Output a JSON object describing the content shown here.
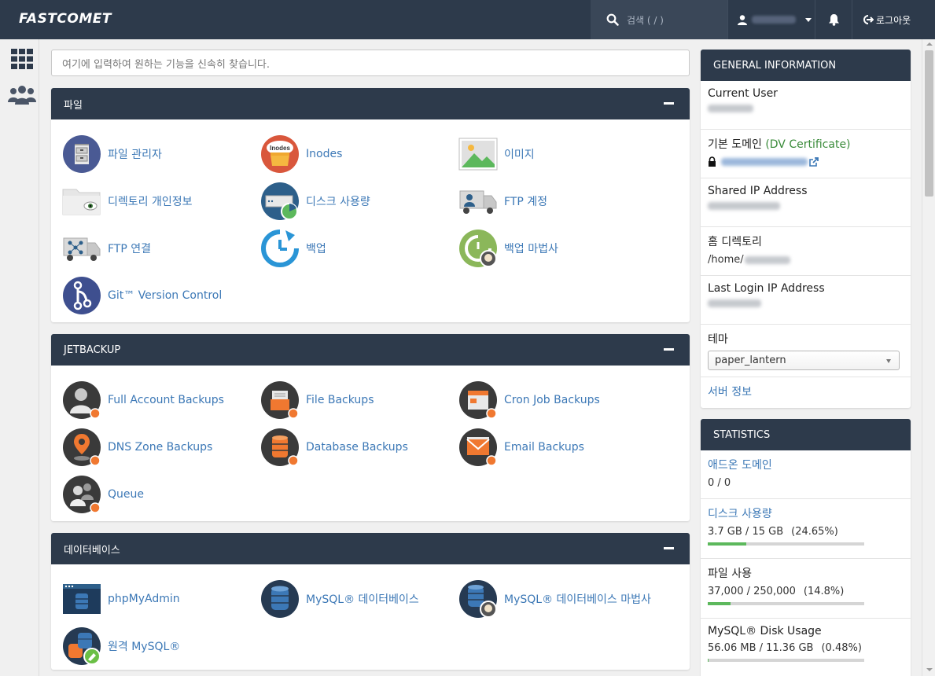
{
  "topbar": {
    "logo": "FASTCOMET",
    "search_placeholder": "검색 ( / )",
    "logout_label": "로그아웃"
  },
  "search": {
    "placeholder": "여기에 입력하여 원하는 기능을 신속히 찾습니다."
  },
  "panels": [
    {
      "title": "파일",
      "items": [
        {
          "label": "파일 관리자",
          "icon": "file-manager-icon"
        },
        {
          "label": "Inodes",
          "icon": "inodes-icon",
          "icon_text": "Inodes"
        },
        {
          "label": "이미지",
          "icon": "images-icon"
        },
        {
          "label": "디렉토리 개인정보",
          "icon": "directory-privacy-icon"
        },
        {
          "label": "디스크 사용량",
          "icon": "disk-usage-icon"
        },
        {
          "label": "FTP 계정",
          "icon": "ftp-accounts-icon"
        },
        {
          "label": "FTP 연결",
          "icon": "ftp-connections-icon"
        },
        {
          "label": "백업",
          "icon": "backup-icon"
        },
        {
          "label": "백업 마법사",
          "icon": "backup-wizard-icon"
        },
        {
          "label": "Git™ Version Control",
          "icon": "git-icon"
        }
      ]
    },
    {
      "title": "JETBACKUP",
      "items": [
        {
          "label": "Full Account Backups",
          "icon": "full-account-backups-icon"
        },
        {
          "label": "File Backups",
          "icon": "file-backups-icon"
        },
        {
          "label": "Cron Job Backups",
          "icon": "cron-job-backups-icon"
        },
        {
          "label": "DNS Zone Backups",
          "icon": "dns-zone-backups-icon"
        },
        {
          "label": "Database Backups",
          "icon": "database-backups-icon"
        },
        {
          "label": "Email Backups",
          "icon": "email-backups-icon"
        },
        {
          "label": "Queue",
          "icon": "queue-icon"
        }
      ]
    },
    {
      "title": "데이터베이스",
      "items": [
        {
          "label": "phpMyAdmin",
          "icon": "phpmyadmin-icon"
        },
        {
          "label": "MySQL® 데이터베이스",
          "icon": "mysql-databases-icon"
        },
        {
          "label": "MySQL® 데이터베이스 마법사",
          "icon": "mysql-wizard-icon"
        },
        {
          "label": "원격 MySQL®",
          "icon": "remote-mysql-icon"
        }
      ]
    }
  ],
  "general_info": {
    "title": "GENERAL INFORMATION",
    "current_user_label": "Current User",
    "primary_domain_label": "기본 도메인",
    "dv_label": "(DV Certificate)",
    "shared_ip_label": "Shared IP Address",
    "home_dir_label": "홈 디렉토리",
    "home_dir_value": "/home/",
    "last_login_label": "Last Login IP Address",
    "theme_label": "테마",
    "theme_value": "paper_lantern",
    "server_info_link": "서버 정보"
  },
  "statistics": {
    "title": "STATISTICS",
    "rows": [
      {
        "label": "애드온 도메인",
        "value": "0 / 0",
        "pct": "",
        "fill": 0,
        "link": true,
        "bar": false
      },
      {
        "label": "디스크 사용량",
        "value": "3.7 GB / 15 GB",
        "pct": "(24.65%)",
        "fill": 24.65,
        "link": true,
        "bar": true
      },
      {
        "label": "파일 사용",
        "value": "37,000 / 250,000",
        "pct": "(14.8%)",
        "fill": 14.8,
        "link": false,
        "bar": true
      },
      {
        "label": "MySQL® Disk Usage",
        "value": "56.06 MB / 11.36 GB",
        "pct": "(0.48%)",
        "fill": 0.48,
        "link": false,
        "bar": true
      }
    ]
  },
  "colors": {
    "header": "#2d3a4b",
    "link": "#3c78b6",
    "progress": "#5cb85c"
  }
}
